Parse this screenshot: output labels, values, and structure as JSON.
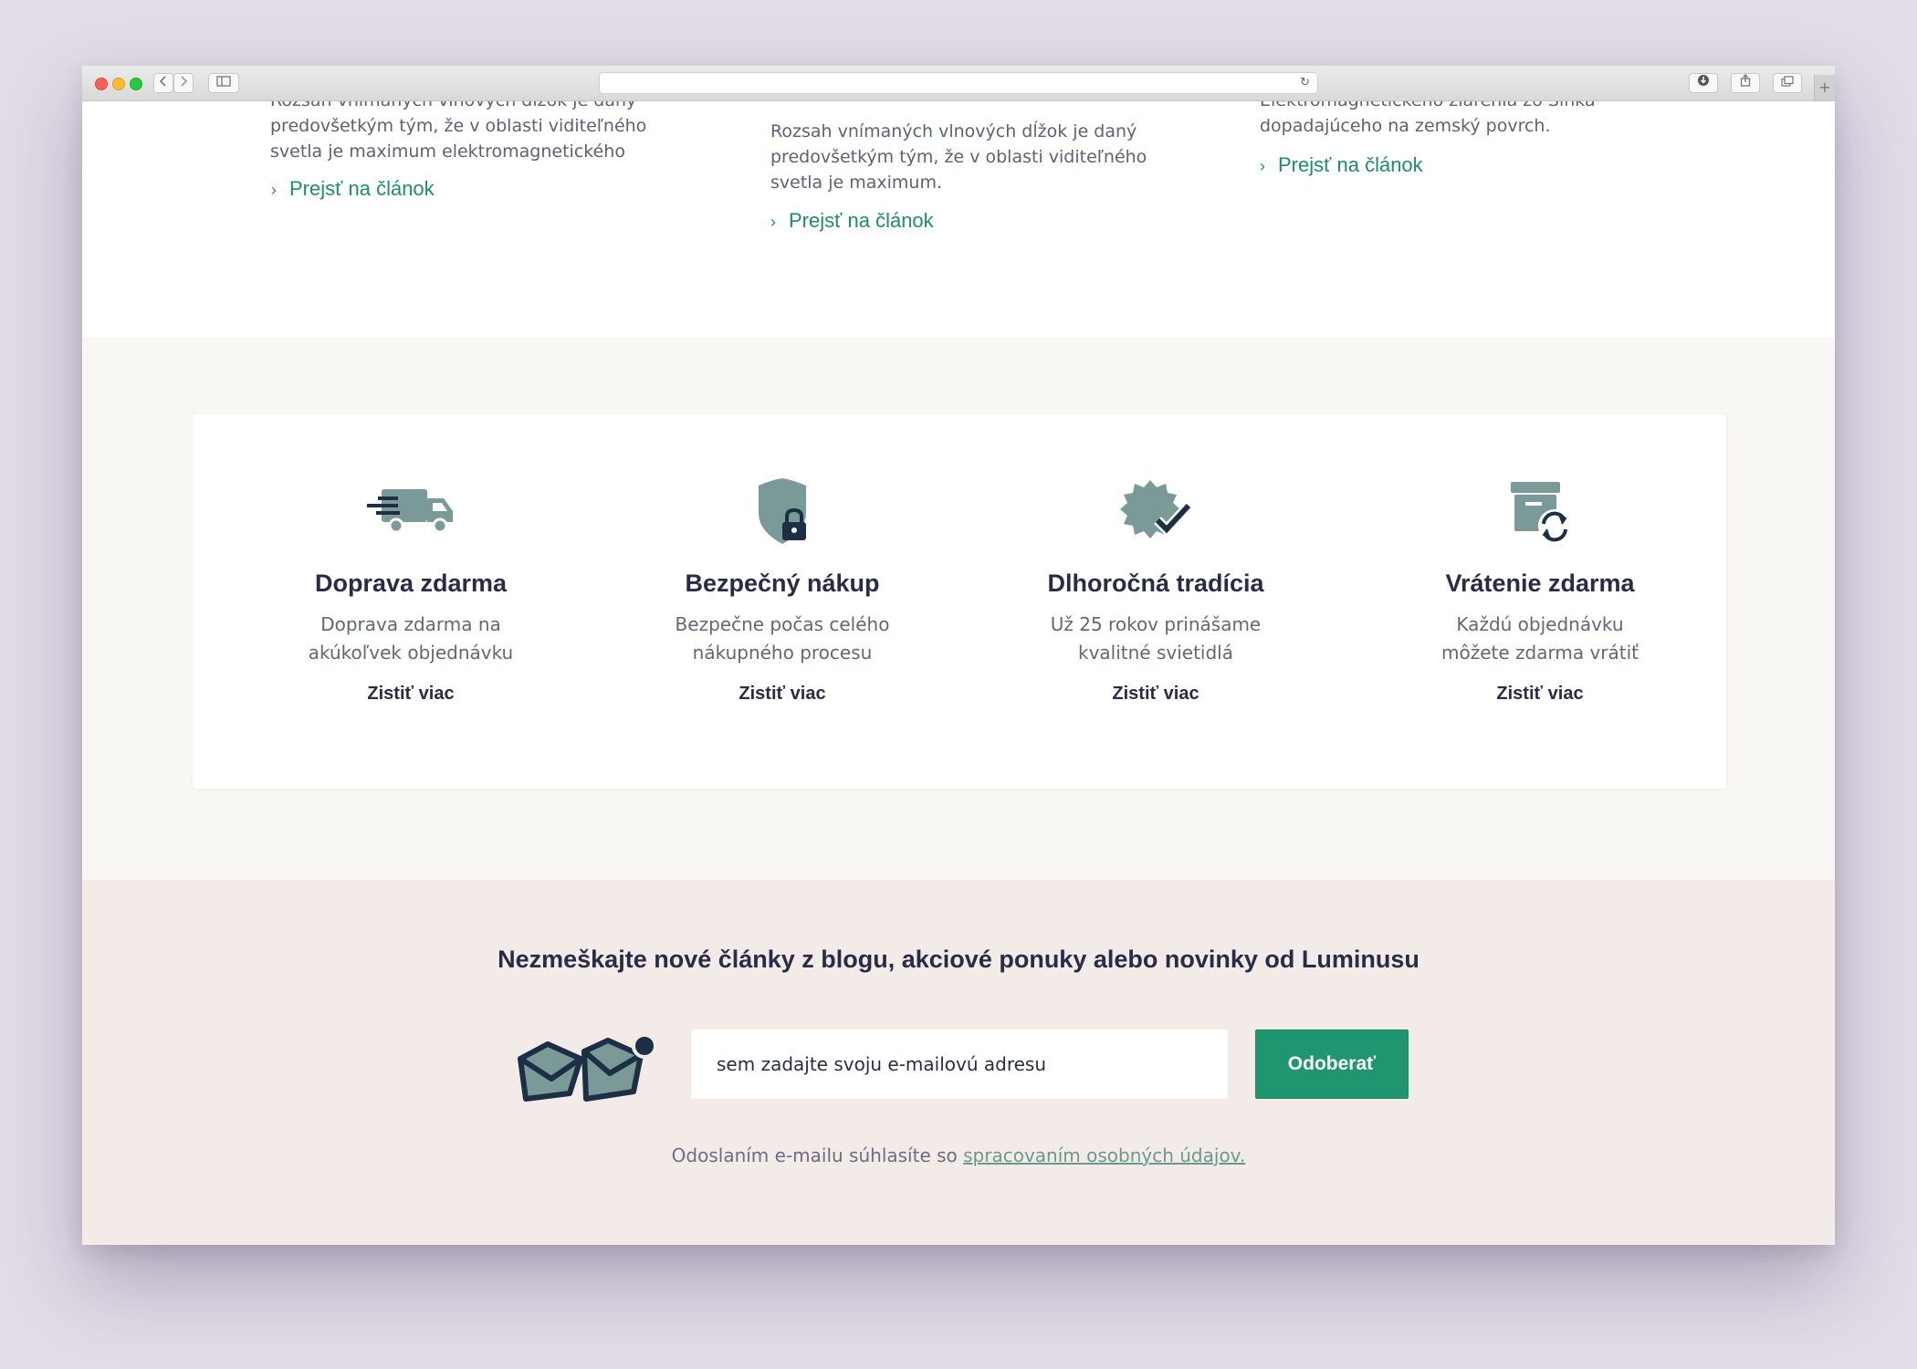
{
  "colors": {
    "accent_green": "#1f9670",
    "link_green": "#1f8c68",
    "icon_teal": "#7a9a98",
    "icon_navy": "#1d2f45",
    "heading": "#2a2c47",
    "body_text": "#63657a"
  },
  "browser": {
    "url": "",
    "back_icon": "chevron-left-icon",
    "forward_icon": "chevron-right-icon",
    "sidebar_icon": "sidebar-icon",
    "reload_icon": "reload-icon",
    "download_icon": "download-icon",
    "share_icon": "share-icon",
    "tabs_icon": "tabs-icon",
    "new_tab": "+"
  },
  "articles": [
    {
      "lines": [
        "Rozsah vnímaných vlnových dĺžok je daný",
        "predovšetkým tým, že v oblasti viditeľného",
        "svetla je maximum elektromagnetického"
      ],
      "link": "Prejsť na článok"
    },
    {
      "lines": [
        "Rozsah vnímaných vlnových dĺžok je daný",
        "predovšetkým tým, že v oblasti viditeľného",
        "svetla je maximum."
      ],
      "link": "Prejsť na článok"
    },
    {
      "lines": [
        "Elektromagnetického žiarenia zo Slnka",
        "dopadajúceho na zemský povrch."
      ],
      "link": "Prejsť na článok"
    }
  ],
  "features": [
    {
      "icon": "delivery-truck-icon",
      "title": "Doprava zdarma",
      "desc1": "Doprava zdarma na",
      "desc2": "akúkoľvek objednávku",
      "link": "Zistiť viac"
    },
    {
      "icon": "shield-lock-icon",
      "title": "Bezpečný nákup",
      "desc1": "Bezpečne počas celého",
      "desc2": "nákupného procesu",
      "link": "Zistiť viac"
    },
    {
      "icon": "badge-check-icon",
      "title": "Dlhoročná tradícia",
      "desc1": "Už 25 rokov prinášame",
      "desc2": "kvalitné svietidlá",
      "link": "Zistiť viac"
    },
    {
      "icon": "return-box-icon",
      "title": "Vrátenie zdarma",
      "desc1": "Každú objednávku",
      "desc2": "môžete zdarma vrátiť",
      "link": "Zistiť viac"
    }
  ],
  "newsletter": {
    "title": "Nezmeškajte nové články z blogu, akciové ponuky alebo novinky od Luminusu",
    "icon": "envelopes-icon",
    "input_placeholder": "sem zadajte svoju e-mailovú adresu",
    "button": "Odoberať",
    "consent_text": "Odoslaním e-mailu súhlasíte so ",
    "consent_link": "spracovaním osobných údajov."
  }
}
